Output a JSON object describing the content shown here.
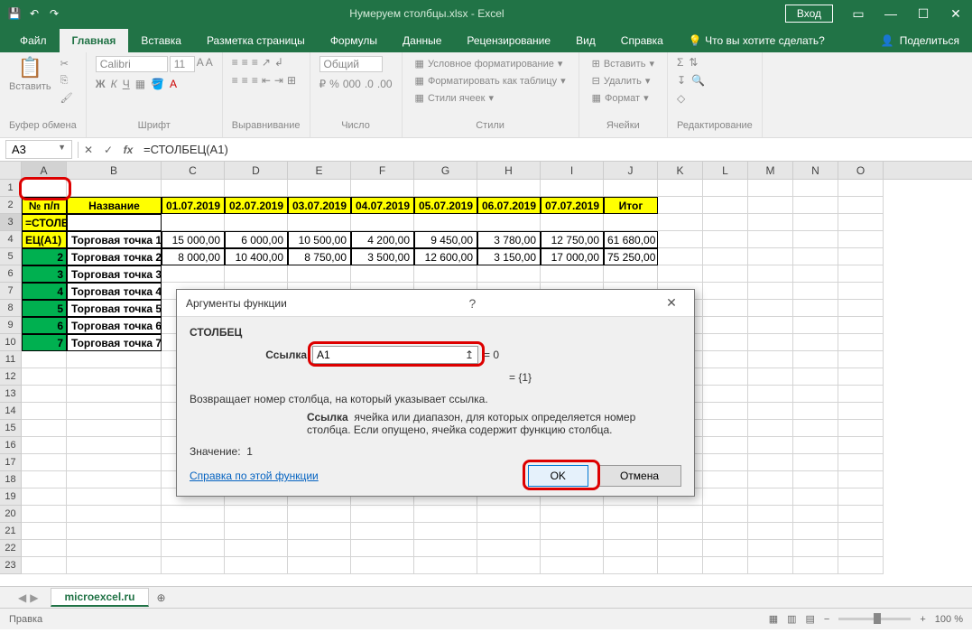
{
  "title": "Нумеруем столбцы.xlsx - Excel",
  "login": "Вход",
  "tabs": {
    "file": "Файл",
    "home": "Главная",
    "insert": "Вставка",
    "layout": "Разметка страницы",
    "formulas": "Формулы",
    "data": "Данные",
    "review": "Рецензирование",
    "view": "Вид",
    "help": "Справка",
    "tellme": "Что вы хотите сделать?",
    "share": "Поделиться"
  },
  "ribbon": {
    "clipboard": "Буфер обмена",
    "paste": "Вставить",
    "font": "Шрифт",
    "fontname": "Calibri",
    "fontsize": "11",
    "bold": "Ж",
    "italic": "К",
    "under": "Ч",
    "alignment": "Выравнивание",
    "number": "Число",
    "numfmt": "Общий",
    "styles": "Стили",
    "condfmt": "Условное форматирование",
    "fmttable": "Форматировать как таблицу",
    "cellstyles": "Стили ячеек",
    "cells": "Ячейки",
    "insert": "Вставить",
    "delete": "Удалить",
    "format": "Формат",
    "editing": "Редактирование"
  },
  "namebox": "A3",
  "formula": "=СТОЛБЕЦ(A1)",
  "cols": [
    "A",
    "B",
    "C",
    "D",
    "E",
    "F",
    "G",
    "H",
    "I",
    "J",
    "K",
    "L",
    "M",
    "N",
    "O"
  ],
  "headers": {
    "npp": "№ п/п",
    "name": "Название",
    "d1": "01.07.2019",
    "d2": "02.07.2019",
    "d3": "03.07.2019",
    "d4": "04.07.2019",
    "d5": "05.07.2019",
    "d6": "06.07.2019",
    "d7": "07.07.2019",
    "total": "Итог"
  },
  "a3": "=СТОЛБ",
  "a4": "ЕЦ(A1)",
  "points": {
    "p1": "Торговая точка 1",
    "p2": "Торговая точка 2",
    "p3": "Торговая точка 3",
    "p4": "Торговая точка 4",
    "p5": "Торговая точка 5",
    "p6": "Торговая точка 6",
    "p7": "Торговая точка 7"
  },
  "nums": {
    "r4": {
      "c": "15 000,00",
      "d": "6 000,00",
      "e": "10 500,00",
      "f": "4 200,00",
      "g": "9 450,00",
      "h": "3 780,00",
      "i": "12 750,00",
      "j": "61 680,00"
    },
    "r5": {
      "c": "8 000,00",
      "d": "10 400,00",
      "e": "8 750,00",
      "f": "3 500,00",
      "g": "12 600,00",
      "h": "3 150,00",
      "i": "17 000,00",
      "j": "75 250,00"
    }
  },
  "rownums": {
    "r5": "2",
    "r6": "3",
    "r7": "4",
    "r8": "5",
    "r9": "6",
    "r10": "7"
  },
  "dialog": {
    "title": "Аргументы функции",
    "func": "СТОЛБЕЦ",
    "arglabel": "Ссылка",
    "argvalue": "A1",
    "argresult": "= 0",
    "arrresult": "= {1}",
    "desc": "Возвращает номер столбца, на который указывает ссылка.",
    "argname": "Ссылка",
    "argdesc": "ячейка или диапазон, для которых определяется номер столбца. Если опущено, ячейка содержит функцию столбца.",
    "resultlabel": "Значение:",
    "resultval": "1",
    "help": "Справка по этой функции",
    "ok": "OK",
    "cancel": "Отмена"
  },
  "sheet": "microexcel.ru",
  "status": "Правка",
  "zoom": "100 %"
}
